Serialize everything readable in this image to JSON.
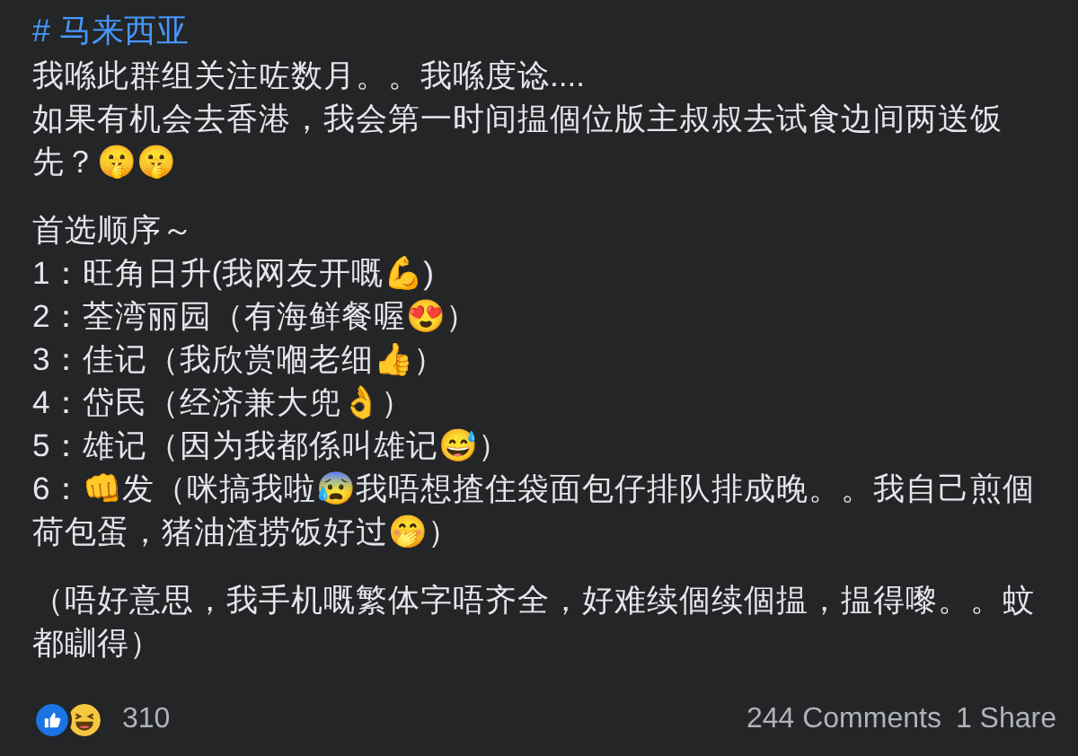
{
  "hashtag": "# 马来西亚",
  "paragraphs": [
    {
      "lines": [
        "我喺此群组关注咗数月。。我喺度谂....",
        "如果有机会去香港，我会第一时间揾個位版主叔叔去试食边间两送饭先？🤫🤫"
      ]
    },
    {
      "lines": [
        "首选顺序～",
        "1：旺角日升(我网友开嘅💪)",
        "2：荃湾丽园（有海鲜餐喔😍）",
        "3：佳记（我欣赏嗰老细👍）",
        "4：岱民（经济兼大兜👌）",
        "5：雄记（因为我都係叫雄记😅）",
        "6：👊发（咪搞我啦😰我唔想揸住袋面包仔排队排成晚。。我自己煎個荷包蛋，猪油渣捞饭好过🤭）"
      ]
    },
    {
      "lines": [
        "（唔好意思，我手机嘅繁体字唔齐全，好难续個续個揾，揾得嚟。。蚊都瞓得）"
      ]
    }
  ],
  "reactions": {
    "items": [
      {
        "kind": "like"
      },
      {
        "kind": "haha"
      }
    ],
    "count": "310"
  },
  "comments": "244 Comments",
  "shares": "1 Share"
}
